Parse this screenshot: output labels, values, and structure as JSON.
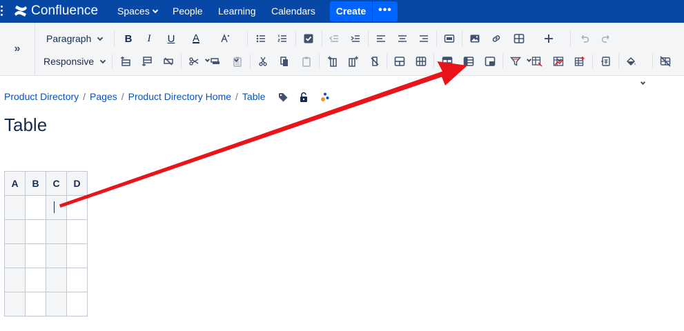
{
  "app": {
    "name": "Confluence"
  },
  "topnav": {
    "items": [
      {
        "label": "Spaces",
        "has_dropdown": true
      },
      {
        "label": "People"
      },
      {
        "label": "Learning"
      },
      {
        "label": "Calendars"
      }
    ],
    "create_label": "Create",
    "more_label": "•••"
  },
  "toolbar": {
    "expand_label": "»",
    "paragraph_select": "Paragraph",
    "responsive_select": "Responsive",
    "bold_label": "B",
    "italic_label": "I",
    "underline_label": "U",
    "text_color_label": "A"
  },
  "breadcrumbs": [
    {
      "label": "Product Directory"
    },
    {
      "label": "Pages"
    },
    {
      "label": "Product Directory Home"
    },
    {
      "label": "Table"
    }
  ],
  "page": {
    "title": "Table"
  },
  "table": {
    "headers": [
      "A",
      "B",
      "C",
      "D"
    ],
    "rows": [
      [
        "",
        "",
        "",
        ""
      ],
      [
        "",
        "",
        "",
        ""
      ],
      [
        "",
        "",
        "",
        ""
      ],
      [
        "",
        "",
        "",
        ""
      ],
      [
        "",
        "",
        "",
        ""
      ]
    ]
  },
  "colors": {
    "nav_bg": "#0747a6",
    "create_button": "#0065ff",
    "link": "#0052cc",
    "annotation_arrow": "#e8141a"
  }
}
